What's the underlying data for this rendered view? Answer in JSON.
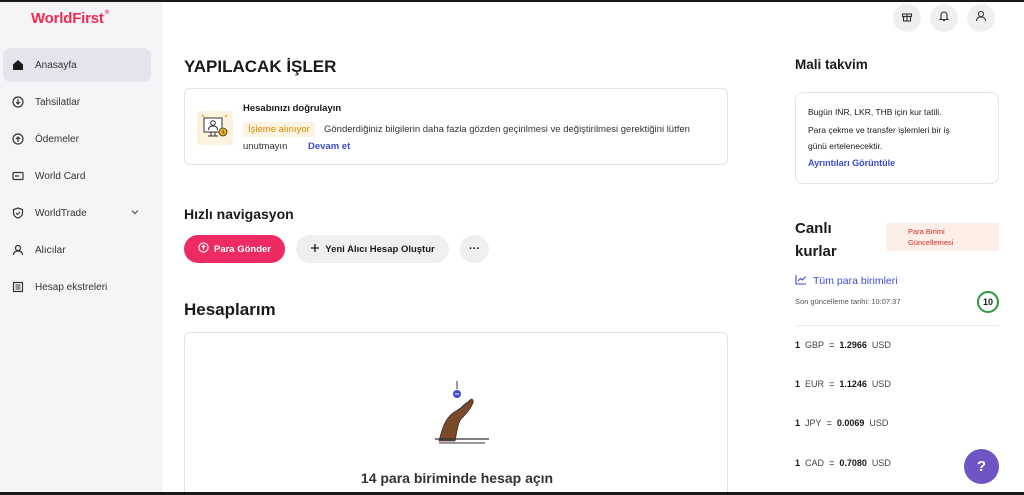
{
  "brand": {
    "logo": "WorldFirst",
    "mark": "®"
  },
  "sidebar": {
    "items": [
      {
        "label": "Anasayfa",
        "icon": "home-icon"
      },
      {
        "label": "Tahsilatlar",
        "icon": "download-icon"
      },
      {
        "label": "Ödemeler",
        "icon": "upload-icon"
      },
      {
        "label": "World Card",
        "icon": "card-icon"
      },
      {
        "label": "WorldTrade",
        "icon": "shield-icon"
      },
      {
        "label": "Alıcılar",
        "icon": "user-icon"
      },
      {
        "label": "Hesap ekstreleri",
        "icon": "statement-icon"
      }
    ]
  },
  "header": {
    "icons": [
      "gift-icon",
      "bell-icon",
      "user-icon"
    ]
  },
  "todo": {
    "title": "YAPILACAK İŞLER",
    "card_title": "Hesabınızı doğrulayın",
    "badge": "İşleme alınıyor",
    "text": "Gönderdiğiniz bilgilerin daha fazla gözden geçirilmesi ve değiştirilmesi gerektiğini lütfen",
    "text2": "unutmayın",
    "link": "Devam et"
  },
  "quick": {
    "title": "Hızlı navigasyon",
    "send_label": "Para Gönder",
    "new_label": "Yeni Alıcı Hesap Oluştur",
    "more_label": "···"
  },
  "accounts": {
    "title": "Hesaplarım",
    "cta": "14 para biriminde hesap açın"
  },
  "calendar": {
    "title": "Mali takvim",
    "line1": "Bugün INR, LKR, THB için kur tatili.",
    "line2": "Para çekme ve transfer işlemleri bir iş",
    "line3": "günü ertelenecektir.",
    "link": "Ayrıntıları Görüntüle"
  },
  "rates": {
    "title_line1": "Canlı",
    "title_line2": "kurlar",
    "badge_line1": "Para Birimi",
    "badge_line2": "Güncellemesi",
    "all_label": "Tüm para birimleri",
    "updated": "Son güncelleme tarihi: 10:07:37",
    "counter": "10",
    "rows": [
      {
        "one": "1",
        "from": "GBP",
        "eq": "=",
        "value": "1.2966",
        "to": "USD"
      },
      {
        "one": "1",
        "from": "EUR",
        "eq": "=",
        "value": "1.1246",
        "to": "USD"
      },
      {
        "one": "1",
        "from": "JPY",
        "eq": "=",
        "value": "0.0069",
        "to": "USD"
      },
      {
        "one": "1",
        "from": "CAD",
        "eq": "=",
        "value": "0.7080",
        "to": "USD"
      }
    ]
  },
  "help": {
    "label": "?"
  },
  "colors": {
    "brand": "#ee2a4f",
    "primary_button": "#ee2a63",
    "link": "#3d4bd4",
    "help": "#6f55c4"
  }
}
